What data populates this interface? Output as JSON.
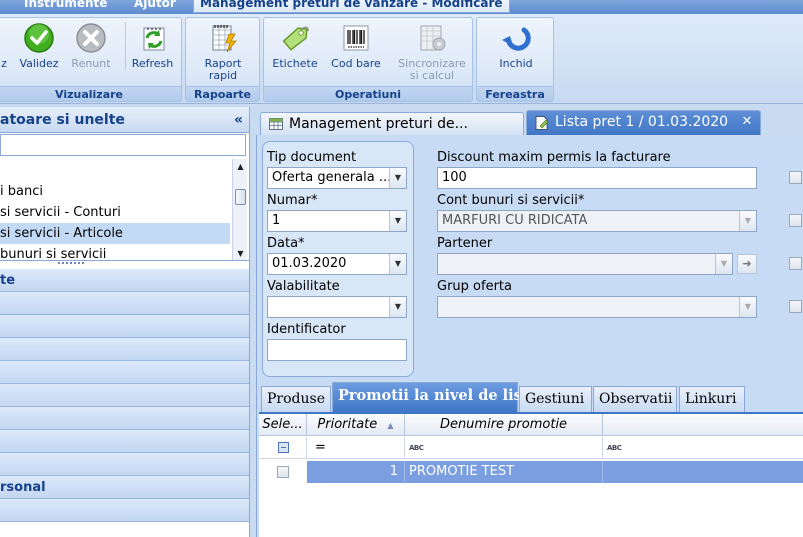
{
  "top_tabs": [
    {
      "label": "Instrumente"
    },
    {
      "label": "Ajutor"
    },
    {
      "label": "Management preturi de vanzare - Modificare"
    }
  ],
  "ribbon": {
    "groups": [
      {
        "title": "Vizualizare",
        "buttons": [
          {
            "label": "z",
            "icon": "cut-off-icon",
            "enabled": true
          },
          {
            "label": "Validez",
            "icon": "check-icon",
            "enabled": true
          },
          {
            "label": "Renunt",
            "icon": "cancel-icon",
            "enabled": false
          },
          {
            "label": "Refresh",
            "icon": "refresh-icon",
            "enabled": true
          }
        ]
      },
      {
        "title": "Rapoarte",
        "buttons": [
          {
            "label": "Raport",
            "label2": "rapid",
            "icon": "report-icon",
            "enabled": true
          }
        ]
      },
      {
        "title": "Operatiuni",
        "buttons": [
          {
            "label": "Etichete",
            "icon": "tag-icon",
            "enabled": true
          },
          {
            "label": "Cod bare",
            "icon": "barcode-icon",
            "enabled": true
          },
          {
            "label": "Sincronizare",
            "label2": "si calcul",
            "icon": "sync-calc-icon",
            "enabled": false
          }
        ]
      },
      {
        "title": "Fereastra",
        "buttons": [
          {
            "label": "Inchid",
            "icon": "close-window-icon",
            "enabled": true
          }
        ]
      }
    ]
  },
  "left_panel": {
    "title": "atoare si unelte",
    "collapse_glyph": "«",
    "tree_items": [
      {
        "label": "i banci",
        "selected": false
      },
      {
        "label": "si servicii - Conturi",
        "selected": false
      },
      {
        "label": "si servicii - Articole",
        "selected": true
      },
      {
        "label": "bunuri si servicii",
        "selected": false
      }
    ],
    "nav_rows": [
      {
        "label": "te"
      },
      {
        "label": ""
      },
      {
        "label": ""
      },
      {
        "label": ""
      },
      {
        "label": ""
      },
      {
        "label": ""
      },
      {
        "label": ""
      },
      {
        "label": ""
      },
      {
        "label": ""
      },
      {
        "label": "rsonal"
      },
      {
        "label": ""
      }
    ]
  },
  "doc_tabs": [
    {
      "label": "Management preturi de...",
      "icon": "grid-icon",
      "active": false
    },
    {
      "label": "Lista pret 1 / 01.03.2020",
      "icon": "document-edit-icon",
      "active": true,
      "close": "✕"
    }
  ],
  "form": {
    "tip_document": {
      "label": "Tip document",
      "value": "Oferta generala ..."
    },
    "numar": {
      "label": "Numar*",
      "value": "1"
    },
    "data": {
      "label": "Data*",
      "value": "01.03.2020"
    },
    "valabilitate": {
      "label": "Valabilitate",
      "value": ""
    },
    "identificator": {
      "label": "Identificator",
      "value": ""
    },
    "discount": {
      "label": "Discount maxim permis la facturare",
      "value": "100"
    },
    "cont": {
      "label": "Cont bunuri si servicii*",
      "value": "MARFURI CU RIDICATA"
    },
    "partener": {
      "label": "Partener",
      "value": ""
    },
    "grup_oferta": {
      "label": "Grup oferta",
      "value": ""
    }
  },
  "sub_tabs": [
    {
      "label": "Produse",
      "active": false
    },
    {
      "label": "Promotii la nivel de lista",
      "active": true
    },
    {
      "label": "Gestiuni",
      "active": false
    },
    {
      "label": "Observatii",
      "active": false
    },
    {
      "label": "Linkuri",
      "active": false
    }
  ],
  "grid": {
    "columns": [
      "Sele...",
      "Prioritate",
      "Denumire promotie"
    ],
    "filter_row": {
      "priority_op": "=",
      "text_filter_glyph": "ABC"
    },
    "rows": [
      {
        "selected": false,
        "prioritate": "1",
        "denumire": "PROMOTIE TEST"
      }
    ]
  },
  "colors": {
    "accent": "#3f77c8",
    "ribbon_title": "#15428b",
    "row_highlight": "#7a9ee0"
  }
}
